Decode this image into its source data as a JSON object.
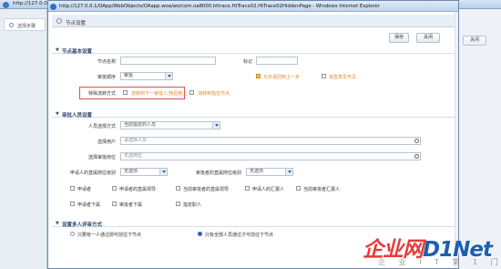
{
  "bg_window": {
    "title": "http://127.0.0.1/",
    "left_tab": "选择步骤",
    "close_label": "关闭"
  },
  "dialog": {
    "title": "http://127.0.0.1/OApp/WebObjects/OAapp.woa/wo/com.oa8000.httrace.HtTrace02.HtTrace02HiddenPage - Windows Internet Explorer",
    "header": "节点设置",
    "save_label": "保存",
    "close_label": "关闭"
  },
  "basic": {
    "title": "节点基本设置",
    "node_name_label": "节点名称",
    "node_name_value": "",
    "mark_label": "标记",
    "mark_value": "",
    "approve_order_label": "审批顺序",
    "approve_order_value": "审批",
    "allow_back_label": "允许退回到上一步",
    "allow_back_checked": true,
    "approve_other_label": "批签意见可见",
    "special_label": "特殊流转方式",
    "special_opt1": "流转到下一审批人/按回到上",
    "special_opt2": "流转到指定节点"
  },
  "approver": {
    "title": "审批人员设置",
    "method_label": "人员选择方式",
    "method_value": "当前指定的人员",
    "user_label": "选择用户",
    "user_placeholder": "请选择人员",
    "position_label": "选择审批岗位",
    "position_placeholder": "无选岗位",
    "dept_level_label": "申请人的直属岗位级别",
    "dept_level_value": "无选项",
    "approve_level_label": "审批者的直属岗位级别",
    "approve_level_value": "无选项",
    "opts": [
      "申请者",
      "申请者的直属领导",
      "当前审批者的直属领导",
      "申请人的汇报人",
      "当前审批者汇报人",
      "申请者下属",
      "审批者下属",
      "指定职人"
    ]
  },
  "multi": {
    "title": "设置多人评审方式",
    "opt1": "只要有一人通过即可前往下节点",
    "opt2": "只有全部人员通过才可前往下节点"
  },
  "watermark": {
    "brand": "企业网D1Net",
    "sub": "企 业 I T 第 1 门 户"
  }
}
